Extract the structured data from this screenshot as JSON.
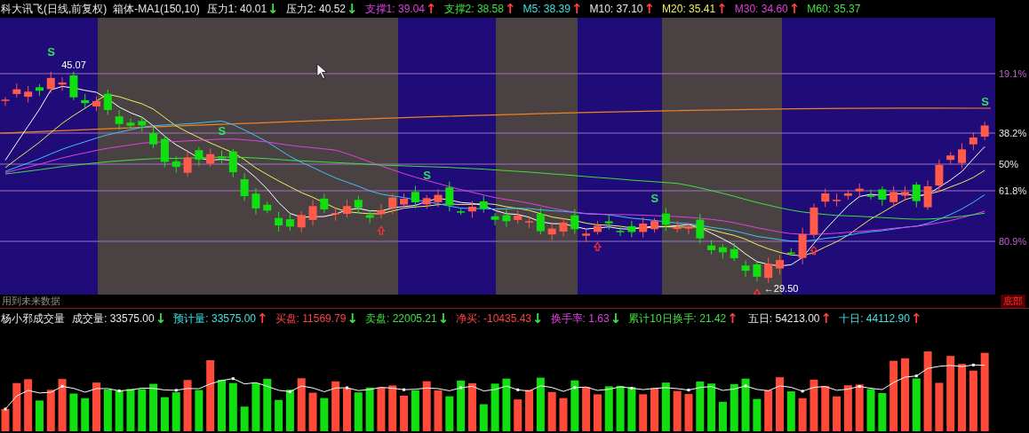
{
  "header": {
    "title": "科大讯飞(日线,前复权)",
    "indicator": "箱体-MA1(150,10)",
    "items": [
      {
        "text": "压力1: 40.01",
        "color": "#e8e8e8",
        "arrow": {
          "text": "↓",
          "color": "#40e040"
        }
      },
      {
        "text": "压力2: 40.52",
        "color": "#e8e8e8",
        "arrow": {
          "text": "↓",
          "color": "#40e040"
        }
      },
      {
        "text": "支撑1: 39.04",
        "color": "#e040e0",
        "arrow": {
          "text": "↑",
          "color": "#ff4040"
        }
      },
      {
        "text": "支撑2: 38.58",
        "color": "#40e040",
        "arrow": {
          "text": "↑",
          "color": "#ff4040"
        }
      },
      {
        "text": "M5: 38.39",
        "color": "#40e0e0",
        "arrow": {
          "text": "↑",
          "color": "#ff4040"
        }
      },
      {
        "text": "M10: 37.10",
        "color": "#e8e8e8",
        "arrow": {
          "text": "↑",
          "color": "#ff4040"
        }
      },
      {
        "text": "M20: 35.41",
        "color": "#f0f060",
        "arrow": {
          "text": "↑",
          "color": "#ff4040"
        }
      },
      {
        "text": "M30: 34.60",
        "color": "#e040e0",
        "arrow": {
          "text": "↑",
          "color": "#ff4040"
        }
      },
      {
        "text": "M60: 35.37",
        "color": "#40e040"
      }
    ]
  },
  "chart": {
    "axis_labels": [
      "19.1%",
      "38.2%",
      "50%",
      "61.8%",
      "80.9%"
    ],
    "signals": [
      {
        "text": "S"
      },
      {
        "text": "S"
      },
      {
        "text": "S"
      },
      {
        "text": "S"
      },
      {
        "text": "S"
      }
    ],
    "price_labels": [
      {
        "kind": "high",
        "text": "45.07"
      },
      {
        "kind": "low",
        "text": "←29.50"
      }
    ],
    "note": "用到未来数据",
    "bottom_label": "底部"
  },
  "volume": {
    "title": "杨小邪成交量",
    "items": [
      {
        "text": "成交量: 33575.00",
        "color": "#e8e8e8",
        "arrow": {
          "text": "↓",
          "color": "#40e040"
        }
      },
      {
        "text": "预计量: 33575.00",
        "color": "#40e0e0",
        "arrow": {
          "text": "↑",
          "color": "#ff4040"
        }
      },
      {
        "text": "买盘: 11569.79",
        "color": "#ff4040",
        "arrow": {
          "text": "↓",
          "color": "#40e040"
        }
      },
      {
        "text": "卖盘: 22005.21",
        "color": "#40e040",
        "arrow": {
          "text": "↓",
          "color": "#40e040"
        }
      },
      {
        "text": "净买: -10435.43",
        "color": "#ff4040",
        "arrow": {
          "text": "↓",
          "color": "#40e040"
        }
      },
      {
        "text": "换手率: 1.63",
        "color": "#e040e0",
        "arrow": {
          "text": "↓",
          "color": "#40e040"
        }
      },
      {
        "text": "累计10日换手: 21.42",
        "color": "#40e040",
        "arrow": {
          "text": "↑",
          "color": "#ff4040"
        }
      }
    ],
    "averages": [
      {
        "text": "五日: 54213.00",
        "color": "#e8e8e8",
        "arrow": {
          "text": "↑",
          "color": "#ff4040"
        }
      },
      {
        "text": "十日: 44112.90",
        "color": "#40e0e0",
        "arrow": {
          "text": "↑",
          "color": "#ff4040"
        }
      }
    ]
  }
}
